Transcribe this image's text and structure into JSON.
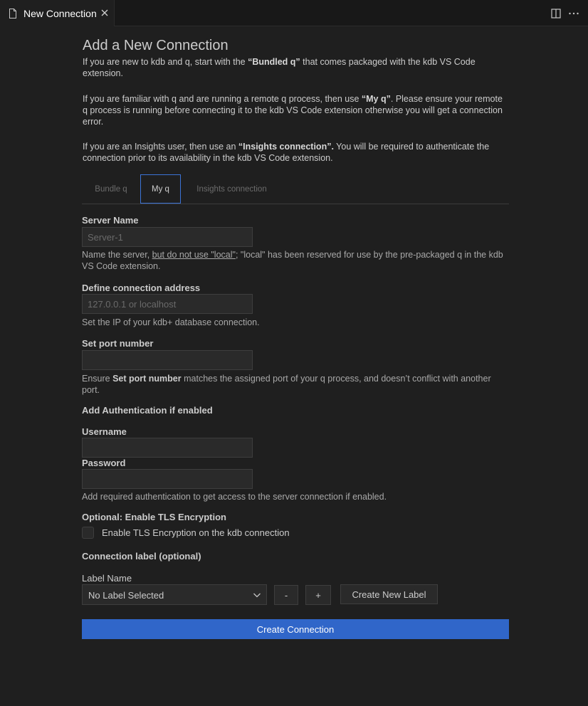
{
  "editor": {
    "tab_title": "New Connection",
    "actions": [
      "split-editor-icon",
      "more-actions-icon"
    ]
  },
  "intro": {
    "heading": "Add a New Connection",
    "p1_a": "If you are new to kdb and q, start with the ",
    "p1_b": "“Bundled q”",
    "p1_c": " that comes packaged with the kdb VS Code extension.",
    "p2_a": "If you are familiar with q and are running a remote q process, then use ",
    "p2_b": "“My q”",
    "p2_c": ". Please ensure your remote q process is running before connecting it to the kdb VS Code extension otherwise you will get a connection error.",
    "p3_a": "If you are an Insights user, then use an ",
    "p3_b": "“Insights connection”.",
    "p3_c": " You will be required to authenticate the connection prior to its availability in the kdb VS Code extension."
  },
  "connection_tabs": [
    {
      "label": "Bundle q",
      "selected": false
    },
    {
      "label": "My q",
      "selected": true
    },
    {
      "label": "Insights connection",
      "selected": false
    }
  ],
  "form": {
    "server_name": {
      "label": "Server Name",
      "placeholder": "Server-1",
      "hint_a": "Name the server, ",
      "hint_u": "but do not use \"local\"",
      "hint_b": "; \"local\" has been reserved for use by the pre-packaged q in the kdb VS Code extension."
    },
    "address": {
      "label": "Define connection address",
      "placeholder": "127.0.0.1 or localhost",
      "hint": "Set the IP of your kdb+ database connection."
    },
    "port": {
      "label": "Set port number",
      "placeholder": "",
      "hint_a": "Ensure ",
      "hint_b": "Set port number",
      "hint_c": " matches the assigned port of your q process, and doesn’t conflict with another port."
    },
    "auth": {
      "section_label": "Add Authentication if enabled",
      "username_label": "Username",
      "password_label": "Password",
      "hint": "Add required authentication to get access to the server connection if enabled."
    },
    "tls": {
      "section_label": "Optional: Enable TLS Encryption",
      "checkbox_label": "Enable TLS Encryption on the kdb connection",
      "checked": false
    },
    "labels": {
      "section_label": "Connection label (optional)",
      "name_label": "Label Name",
      "selected": "No Label Selected",
      "minus": "-",
      "plus": "+",
      "create_new": "Create New Label"
    },
    "submit": "Create Connection"
  },
  "colors": {
    "accent": "#3066c9",
    "tab_border": "#3b73d6",
    "background": "#1f1f1f"
  }
}
